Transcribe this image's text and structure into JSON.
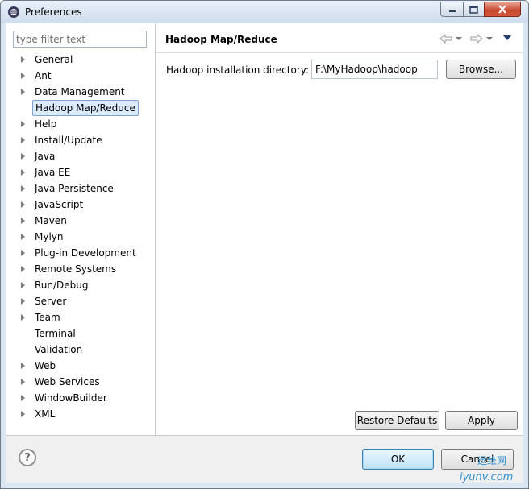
{
  "window": {
    "title": "Preferences"
  },
  "nav": {
    "filter_placeholder": "type filter text",
    "items": [
      {
        "label": "General",
        "expandable": true
      },
      {
        "label": "Ant",
        "expandable": true
      },
      {
        "label": "Data Management",
        "expandable": true
      },
      {
        "label": "Hadoop Map/Reduce",
        "expandable": false,
        "selected": true
      },
      {
        "label": "Help",
        "expandable": true
      },
      {
        "label": "Install/Update",
        "expandable": true
      },
      {
        "label": "Java",
        "expandable": true
      },
      {
        "label": "Java EE",
        "expandable": true
      },
      {
        "label": "Java Persistence",
        "expandable": true
      },
      {
        "label": "JavaScript",
        "expandable": true
      },
      {
        "label": "Maven",
        "expandable": true
      },
      {
        "label": "Mylyn",
        "expandable": true
      },
      {
        "label": "Plug-in Development",
        "expandable": true
      },
      {
        "label": "Remote Systems",
        "expandable": true
      },
      {
        "label": "Run/Debug",
        "expandable": true
      },
      {
        "label": "Server",
        "expandable": true
      },
      {
        "label": "Team",
        "expandable": true
      },
      {
        "label": "Terminal",
        "expandable": false
      },
      {
        "label": "Validation",
        "expandable": false
      },
      {
        "label": "Web",
        "expandable": true
      },
      {
        "label": "Web Services",
        "expandable": true
      },
      {
        "label": "WindowBuilder",
        "expandable": true
      },
      {
        "label": "XML",
        "expandable": true
      }
    ]
  },
  "panel": {
    "title": "Hadoop Map/Reduce",
    "field_label": "Hadoop installation directory:",
    "field_value": "F:\\MyHadoop\\hadoop",
    "browse_label": "Browse...",
    "restore_label": "Restore Defaults",
    "apply_label": "Apply"
  },
  "footer": {
    "help_glyph": "?",
    "ok_label": "OK",
    "cancel_label": "Cancel"
  },
  "watermark": {
    "cn": "运维网",
    "text": "iyunv.com"
  }
}
